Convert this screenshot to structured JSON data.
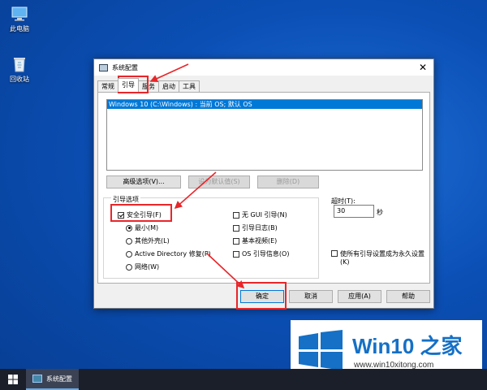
{
  "desktop": {
    "icons": [
      {
        "label": "此电脑",
        "icon": "computer-icon"
      },
      {
        "label": "回收站",
        "icon": "recycle-bin-icon"
      }
    ]
  },
  "dialog": {
    "title": "系统配置",
    "close_glyph": "✕",
    "tabs": [
      {
        "label": "常规",
        "active": false
      },
      {
        "label": "引导",
        "active": true
      },
      {
        "label": "服务",
        "active": false
      },
      {
        "label": "启动",
        "active": false
      },
      {
        "label": "工具",
        "active": false
      }
    ],
    "os_list": [
      "Windows 10 (C:\\Windows) : 当前 OS; 默认 OS"
    ],
    "buttons": {
      "advanced": "高级选项(V)...",
      "set_default": "设为默认值(S)",
      "delete": "删除(D)"
    },
    "boot_options": {
      "label": "引导选项",
      "safe_boot": {
        "label": "安全引导(F)",
        "checked": true
      },
      "minimal": {
        "label": "最小(M)",
        "selected": true
      },
      "alternate_shell": {
        "label": "其他外壳(L)",
        "selected": false
      },
      "active_directory": {
        "label": "Active Directory 修复(P)",
        "selected": false
      },
      "network": {
        "label": "网络(W)",
        "selected": false
      },
      "no_gui": {
        "label": "无 GUI 引导(N)",
        "checked": false
      },
      "boot_log": {
        "label": "引导日志(B)",
        "checked": false
      },
      "base_video": {
        "label": "基本视频(E)",
        "checked": false
      },
      "os_boot_info": {
        "label": "OS 引导信息(O)",
        "checked": false
      }
    },
    "timeout": {
      "label": "超时(T):",
      "value": "30",
      "unit": "秒"
    },
    "make_permanent": {
      "label": "使所有引导设置成为永久设置(K)",
      "checked": false
    },
    "footer": {
      "ok": "确定",
      "cancel": "取消",
      "apply": "应用(A)",
      "help": "帮助"
    }
  },
  "taskbar": {
    "item_label": "系统配置"
  },
  "watermark": {
    "brand": "Win10 之家",
    "url": "www.win10xitong.com"
  },
  "colors": {
    "accent": "#0078d7",
    "annotation": "#e8262a"
  }
}
